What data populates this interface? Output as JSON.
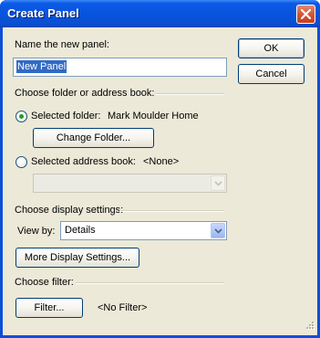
{
  "window": {
    "title": "Create Panel"
  },
  "panel_name": {
    "label": "Name the new panel:",
    "value": "New Panel"
  },
  "buttons": {
    "ok": "OK",
    "cancel": "Cancel"
  },
  "folder_section": {
    "label": "Choose folder or address book:",
    "selected_folder_label": "Selected folder:",
    "selected_folder_value": "Mark Moulder Home",
    "change_folder_button": "Change Folder...",
    "address_book_label": "Selected address book:",
    "address_book_value": "<None>",
    "address_book_combo_value": ""
  },
  "display_section": {
    "label": "Choose display settings:",
    "view_by_label": "View by:",
    "view_by_value": "Details",
    "more_settings_button": "More Display Settings..."
  },
  "filter_section": {
    "label": "Choose filter:",
    "filter_button": "Filter...",
    "filter_value": "<No Filter>"
  },
  "icons": {
    "close": "close-icon",
    "dropdown": "chevron-down-icon",
    "grip": "resize-grip-icon"
  },
  "colors": {
    "title_bar": "#0853dc",
    "dialog_background": "#ece9d8",
    "selection_highlight": "#316ac5",
    "radio_dot": "#21a121",
    "close_button": "#d65a3a"
  }
}
